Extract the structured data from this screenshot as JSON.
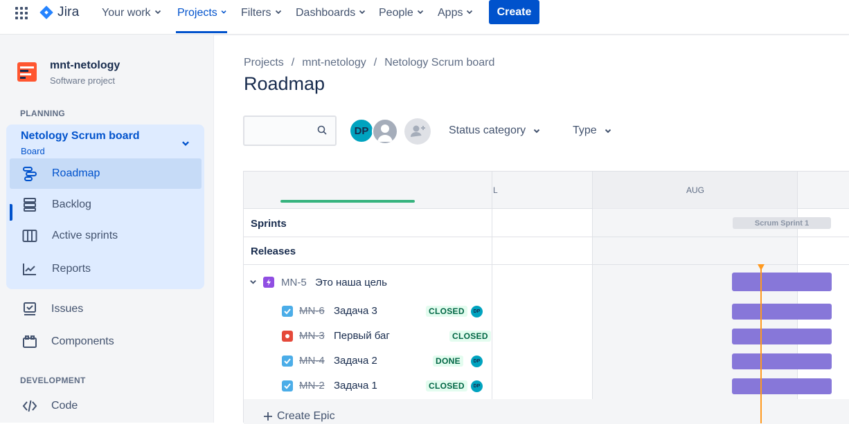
{
  "topnav": {
    "logo": "Jira",
    "items": [
      "Your work",
      "Projects",
      "Filters",
      "Dashboards",
      "People",
      "Apps"
    ],
    "create": "Create"
  },
  "sidebar": {
    "project_name": "mnt-netology",
    "project_type": "Software project",
    "planning_title": "PLANNING",
    "board_name": "Netology Scrum board",
    "board_sub": "Board",
    "board_items": [
      "Roadmap",
      "Backlog",
      "Active sprints",
      "Reports"
    ],
    "other_items": [
      "Issues",
      "Components"
    ],
    "development_title": "DEVELOPMENT",
    "dev_items": [
      "Code"
    ]
  },
  "main": {
    "breadcrumb": [
      "Projects",
      "mnt-netology",
      "Netology Scrum board"
    ],
    "breadcrumb_sep": "/",
    "title": "Roadmap",
    "search_placeholder": "",
    "avatar_initials": "DP",
    "filters": [
      "Status category",
      "Type"
    ]
  },
  "roadmap": {
    "months": [
      "L",
      "AUG"
    ],
    "sprints_label": "Sprints",
    "releases_label": "Releases",
    "sprint_name": "Scrum Sprint 1",
    "epic": {
      "key": "MN-5",
      "title": "Это наша цель"
    },
    "issues": [
      {
        "key": "MN-6",
        "title": "Задача 3",
        "status": "CLOSED",
        "type": "task",
        "assignee": "DP"
      },
      {
        "key": "MN-3",
        "title": "Первый баг",
        "status": "CLOSED",
        "type": "bug",
        "assignee": ""
      },
      {
        "key": "MN-4",
        "title": "Задача 2",
        "status": "DONE",
        "type": "task",
        "assignee": "DP"
      },
      {
        "key": "MN-2",
        "title": "Задача 1",
        "status": "CLOSED",
        "type": "task",
        "assignee": "DP"
      }
    ],
    "create_epic": "Create Epic"
  },
  "colors": {
    "accent": "#0052cc",
    "epic": "#904ee2",
    "bar": "#8777d9",
    "today": "#ff991f",
    "done": "#36b37e",
    "bug": "#e5493a",
    "task": "#4bade8"
  }
}
